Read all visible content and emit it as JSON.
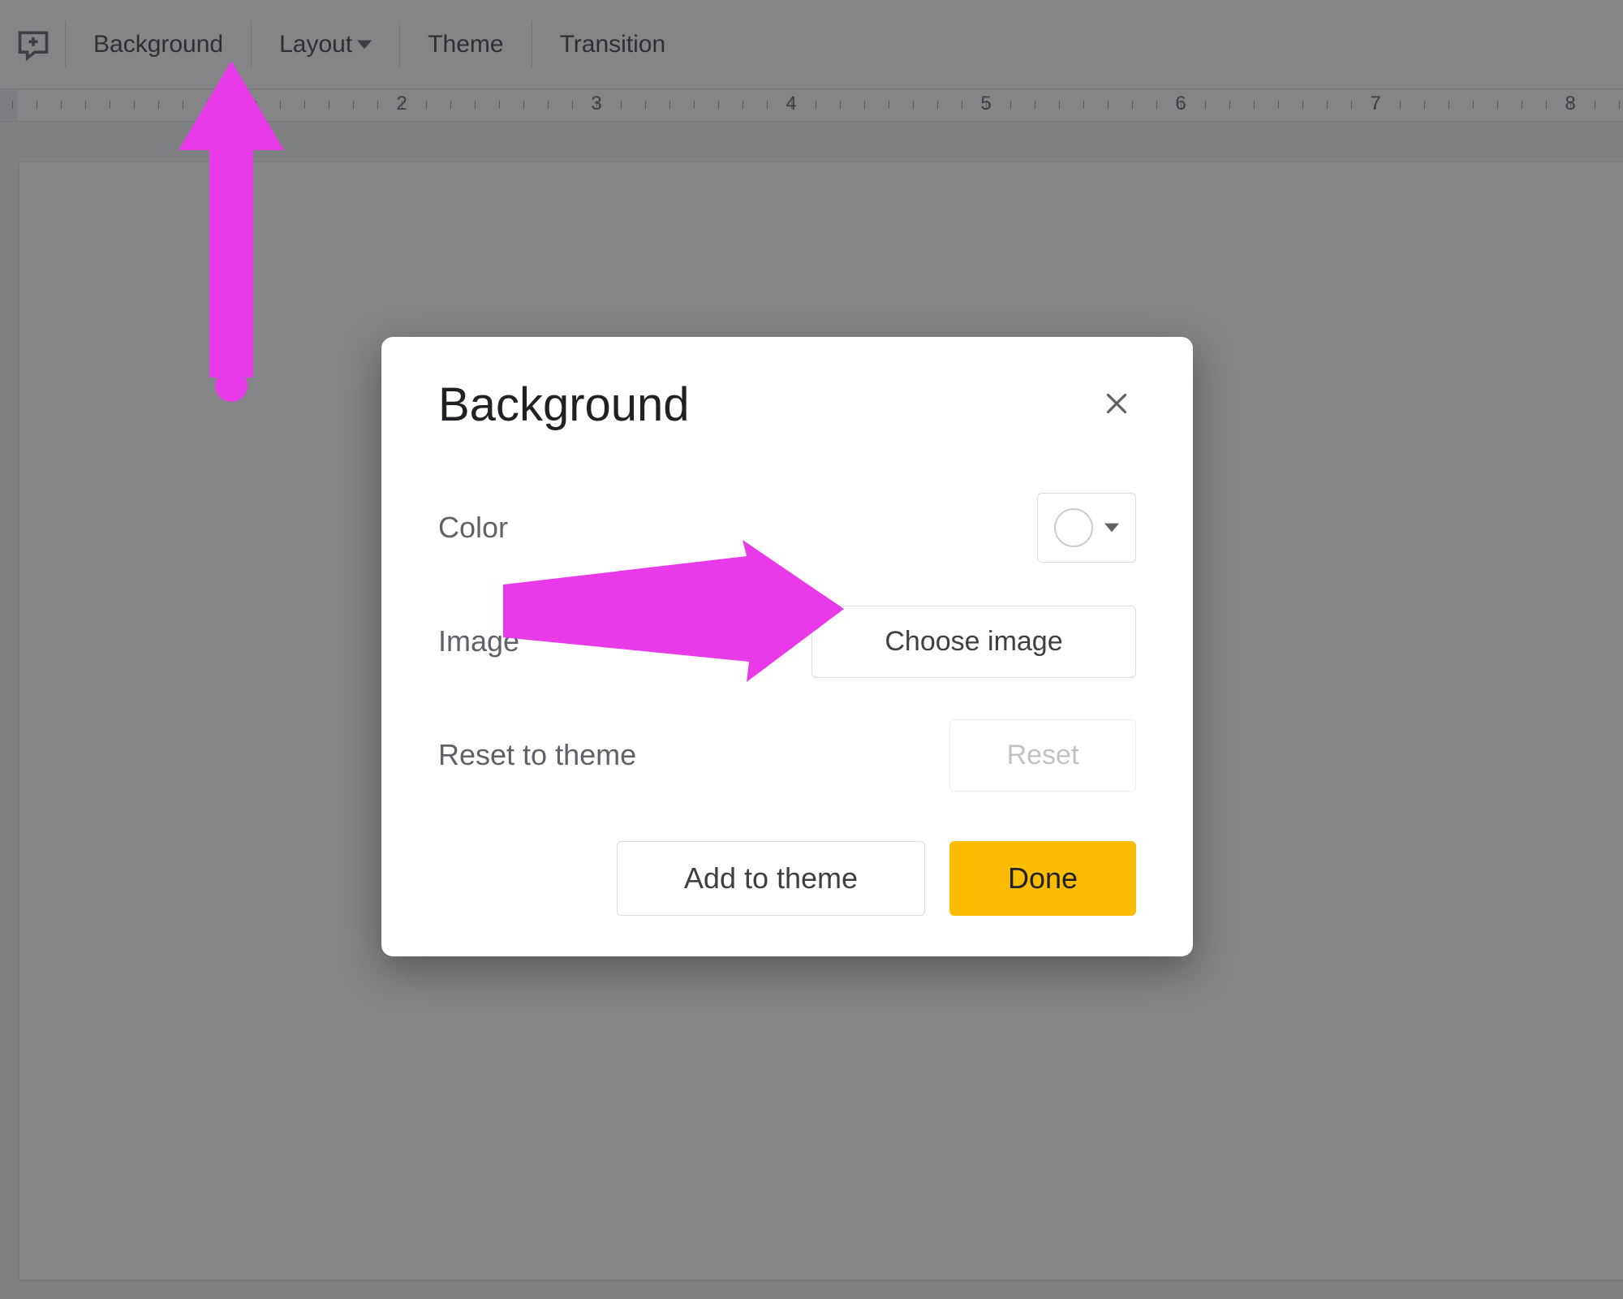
{
  "toolbar": {
    "background_label": "Background",
    "layout_label": "Layout",
    "theme_label": "Theme",
    "transition_label": "Transition"
  },
  "ruler": {
    "numbers": [
      "2",
      "3",
      "4",
      "5",
      "6",
      "7",
      "8"
    ]
  },
  "dialog": {
    "title": "Background",
    "color_label": "Color",
    "image_label": "Image",
    "choose_image_label": "Choose image",
    "reset_to_theme_label": "Reset to theme",
    "reset_label": "Reset",
    "add_to_theme_label": "Add to theme",
    "done_label": "Done"
  },
  "annotation": {
    "color": "#e83ae8"
  }
}
